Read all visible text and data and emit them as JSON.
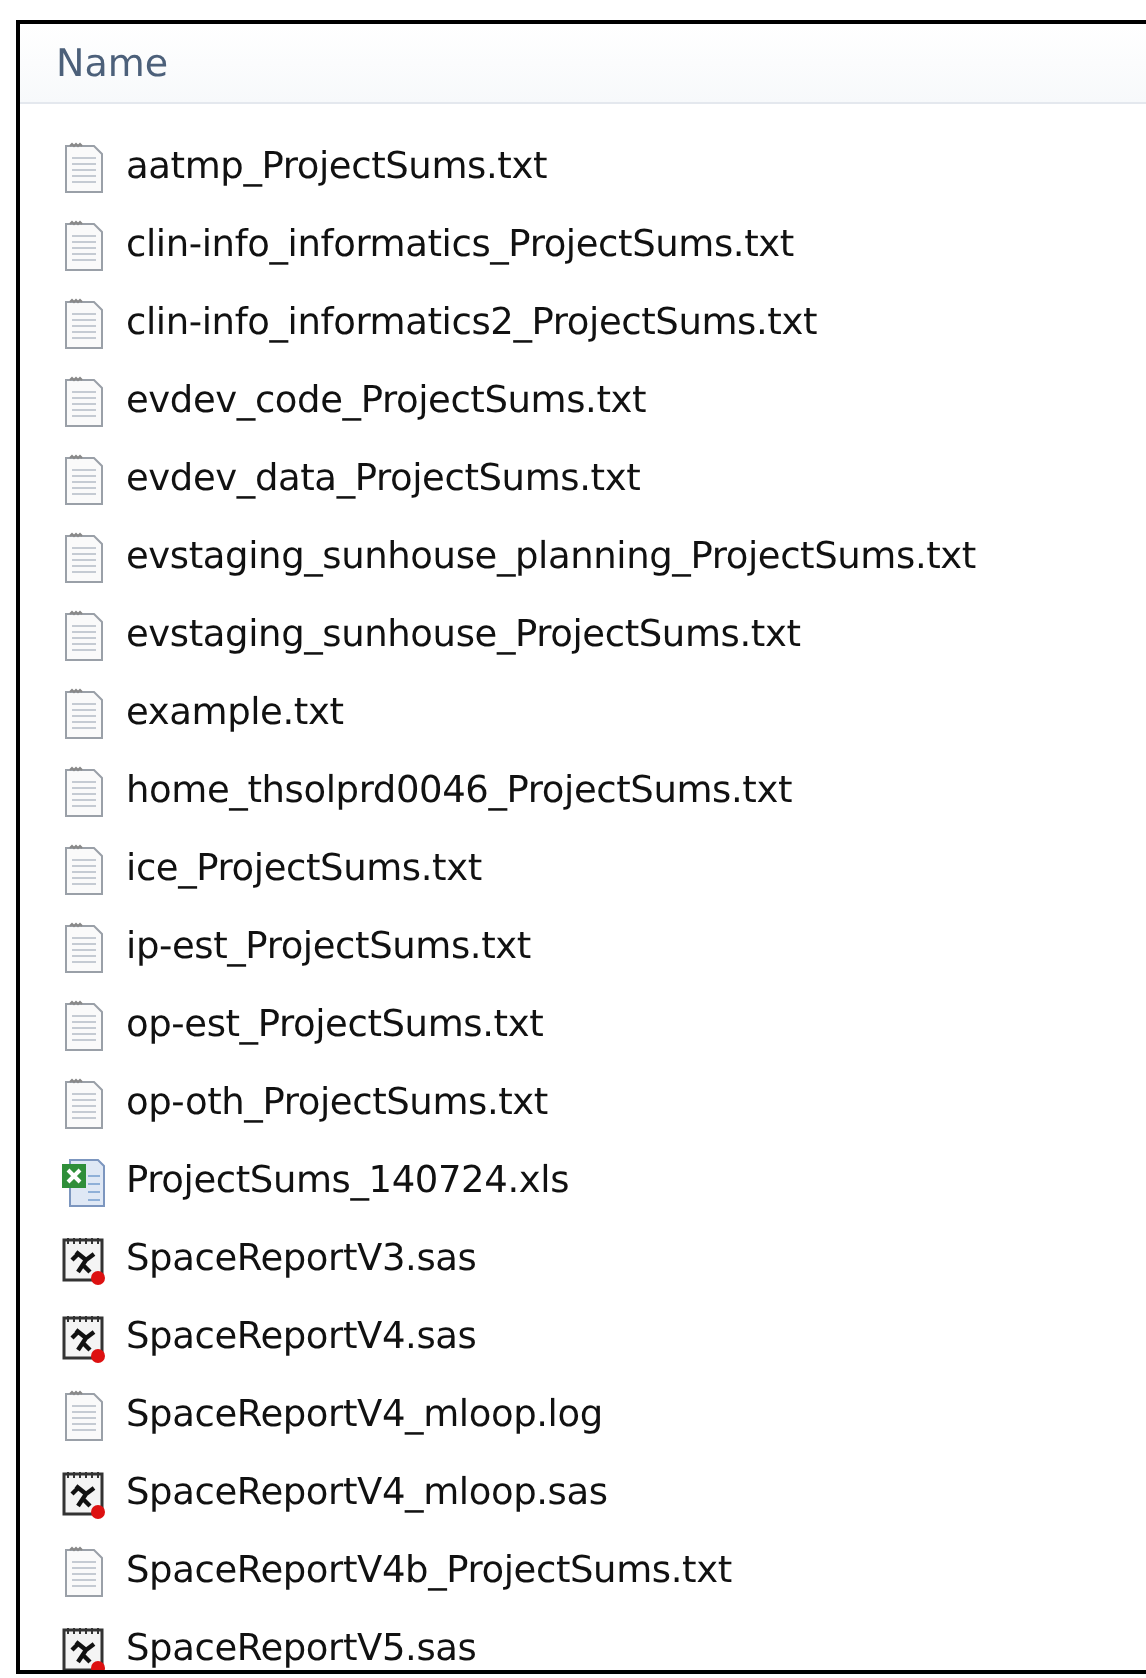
{
  "columns": [
    "Name"
  ],
  "files": [
    {
      "name": "aatmp_ProjectSums.txt",
      "kind": "text"
    },
    {
      "name": "clin-info_informatics_ProjectSums.txt",
      "kind": "text"
    },
    {
      "name": "clin-info_informatics2_ProjectSums.txt",
      "kind": "text"
    },
    {
      "name": "evdev_code_ProjectSums.txt",
      "kind": "text"
    },
    {
      "name": "evdev_data_ProjectSums.txt",
      "kind": "text"
    },
    {
      "name": "evstaging_sunhouse_planning_ProjectSums.txt",
      "kind": "text"
    },
    {
      "name": "evstaging_sunhouse_ProjectSums.txt",
      "kind": "text"
    },
    {
      "name": "example.txt",
      "kind": "text"
    },
    {
      "name": "home_thsolprd0046_ProjectSums.txt",
      "kind": "text"
    },
    {
      "name": "ice_ProjectSums.txt",
      "kind": "text"
    },
    {
      "name": "ip-est_ProjectSums.txt",
      "kind": "text"
    },
    {
      "name": "op-est_ProjectSums.txt",
      "kind": "text"
    },
    {
      "name": "op-oth_ProjectSums.txt",
      "kind": "text"
    },
    {
      "name": "ProjectSums_140724.xls",
      "kind": "spreadsheet"
    },
    {
      "name": "SpaceReportV3.sas",
      "kind": "program"
    },
    {
      "name": "SpaceReportV4.sas",
      "kind": "program"
    },
    {
      "name": "SpaceReportV4_mloop.log",
      "kind": "text"
    },
    {
      "name": "SpaceReportV4_mloop.sas",
      "kind": "program"
    },
    {
      "name": "SpaceReportV4b_ProjectSums.txt",
      "kind": "text"
    },
    {
      "name": "SpaceReportV5.sas",
      "kind": "program"
    }
  ]
}
